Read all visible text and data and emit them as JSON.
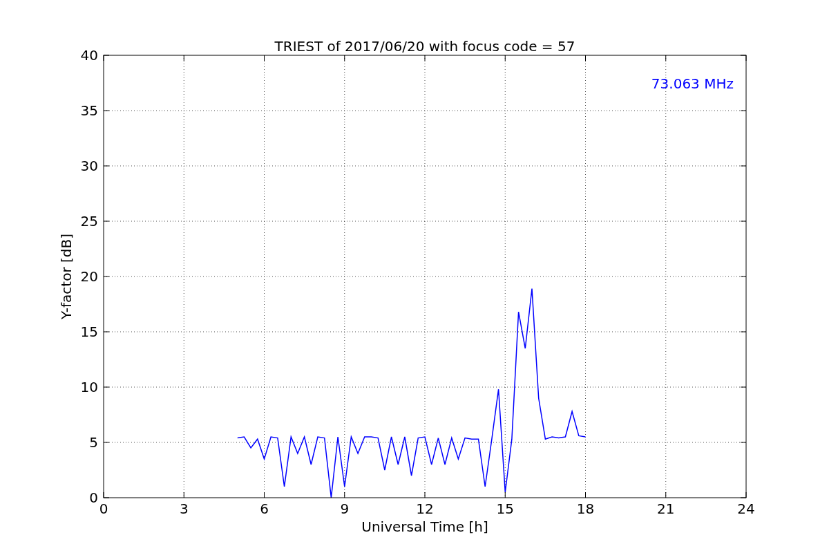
{
  "figure": {
    "chart_data": {
      "type": "line",
      "title": "TRIEST of 2017/06/20 with focus code = 57",
      "xlabel": "Universal Time [h]",
      "ylabel": "Y-factor [dB]",
      "x": [
        5,
        5.25,
        5.5,
        5.75,
        6,
        6.25,
        6.5,
        6.75,
        7,
        7.25,
        7.5,
        7.75,
        8,
        8.25,
        8.5,
        8.75,
        9,
        9.25,
        9.5,
        9.75,
        10,
        10.25,
        10.5,
        10.75,
        11,
        11.25,
        11.5,
        11.75,
        12,
        12.25,
        12.5,
        12.75,
        13,
        13.25,
        13.5,
        13.75,
        14,
        14.25,
        14.5,
        14.75,
        15,
        15.25,
        15.5,
        15.75,
        16,
        16.25,
        16.5,
        16.75,
        17,
        17.25,
        17.5,
        17.75,
        18
      ],
      "series": [
        {
          "name": "73.063 MHz",
          "color": "#0000ff",
          "values": [
            5.4,
            5.5,
            4.5,
            5.3,
            3.5,
            5.5,
            5.4,
            1.0,
            5.5,
            4.0,
            5.5,
            3.0,
            5.5,
            5.4,
            0.0,
            5.5,
            1.0,
            5.5,
            4.0,
            5.5,
            5.5,
            5.4,
            2.5,
            5.5,
            3.0,
            5.5,
            2.0,
            5.4,
            5.5,
            3.0,
            5.4,
            3.0,
            5.4,
            3.5,
            5.4,
            5.3,
            5.3,
            1.0,
            5.3,
            9.8,
            0.5,
            5.3,
            16.8,
            13.5,
            18.9,
            9.0,
            5.3,
            5.5,
            5.4,
            5.5,
            7.8,
            5.6,
            5.5
          ]
        }
      ],
      "xlim": [
        0,
        24
      ],
      "ylim": [
        0,
        40
      ],
      "xticks": [
        0,
        3,
        6,
        9,
        12,
        15,
        18,
        21,
        24
      ],
      "yticks": [
        0,
        5,
        10,
        15,
        20,
        25,
        30,
        35,
        40
      ],
      "grid": true
    }
  }
}
